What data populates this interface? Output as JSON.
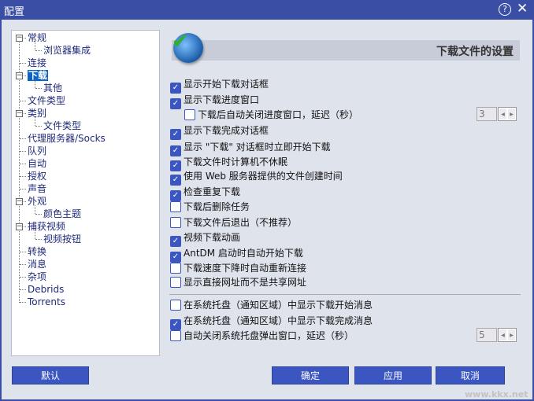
{
  "window": {
    "title": "配置",
    "help_icon": "?",
    "close_icon": "✕"
  },
  "tree": [
    {
      "label": "常规",
      "level": 0,
      "expanded": true
    },
    {
      "label": "浏览器集成",
      "level": 1
    },
    {
      "label": "连接",
      "level": 0
    },
    {
      "label": "下载",
      "level": 0,
      "expanded": true,
      "selected": true
    },
    {
      "label": "其他",
      "level": 1
    },
    {
      "label": "文件类型",
      "level": 0
    },
    {
      "label": "类别",
      "level": 0,
      "expanded": true
    },
    {
      "label": "文件类型",
      "level": 1
    },
    {
      "label": "代理服务器/Socks",
      "level": 0
    },
    {
      "label": "队列",
      "level": 0
    },
    {
      "label": "自动",
      "level": 0
    },
    {
      "label": "授权",
      "level": 0
    },
    {
      "label": "声音",
      "level": 0
    },
    {
      "label": "外观",
      "level": 0,
      "expanded": true
    },
    {
      "label": "颜色主题",
      "level": 1
    },
    {
      "label": "捕获视频",
      "level": 0,
      "expanded": true
    },
    {
      "label": "视频按钮",
      "level": 1
    },
    {
      "label": "转换",
      "level": 0
    },
    {
      "label": "消息",
      "level": 0
    },
    {
      "label": "杂项",
      "level": 0
    },
    {
      "label": "Debrids",
      "level": 0
    },
    {
      "label": "Torrents",
      "level": 0
    }
  ],
  "panel": {
    "title": "下载文件的设置"
  },
  "options": [
    {
      "label": "显示开始下载对话框",
      "checked": true
    },
    {
      "label": "显示下载进度窗口",
      "checked": true
    },
    {
      "label": "下载后自动关闭进度窗口，延迟（秒）",
      "checked": false,
      "indent": true,
      "spin": "3"
    },
    {
      "label": "显示下载完成对话框",
      "checked": true
    },
    {
      "label": "显示 \"下载\" 对话框时立即开始下载",
      "checked": true
    },
    {
      "label": "下载文件时计算机不休眠",
      "checked": true
    },
    {
      "label": "使用 Web 服务器提供的文件创建时间",
      "checked": true
    },
    {
      "label": "检查重复下载",
      "checked": true
    },
    {
      "label": "下载后删除任务",
      "checked": false
    },
    {
      "label": "下载文件后退出（不推荐）",
      "checked": false
    },
    {
      "label": "视频下载动画",
      "checked": true
    },
    {
      "label": "AntDM 启动时自动开始下载",
      "checked": true
    },
    {
      "label": "下载速度下降时自动重新连接",
      "checked": false
    },
    {
      "label": "显示直接网址而不是共享网址",
      "checked": false
    }
  ],
  "tray_options": [
    {
      "label": "在系统托盘（通知区域）中显示下载开始消息",
      "checked": false
    },
    {
      "label": "在系统托盘（通知区域）中显示下载完成消息",
      "checked": true
    },
    {
      "label": "自动关闭系统托盘弹出窗口，延迟（秒）",
      "checked": false,
      "spin": "5"
    }
  ],
  "buttons": {
    "default": "默认",
    "ok": "确定",
    "apply": "应用",
    "cancel": "取消"
  },
  "watermark": "www.kkx.net"
}
